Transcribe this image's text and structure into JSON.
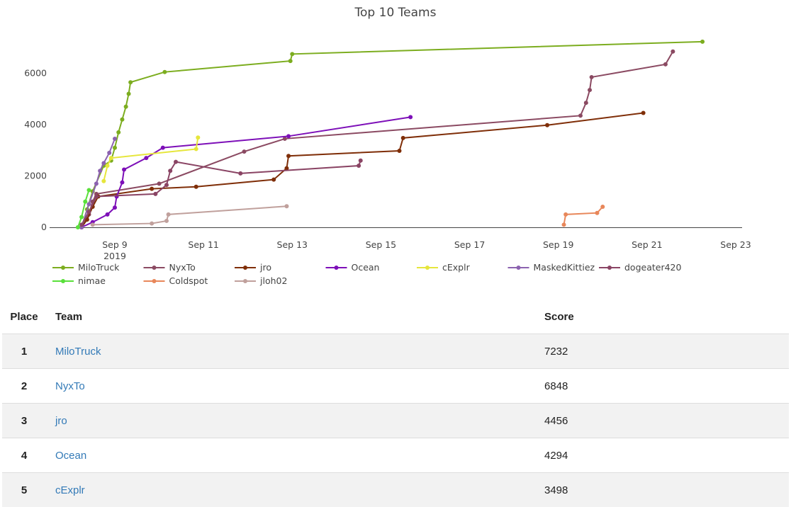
{
  "chart_data": {
    "type": "line",
    "title": "Top 10 Teams",
    "ylim": [
      0,
      7600
    ],
    "y_ticks": [
      0,
      2000,
      4000,
      6000
    ],
    "xlim": [
      "2019-09-07",
      "2019-09-24"
    ],
    "x_ticks": [
      {
        "date": "2019-09-09",
        "label": "Sep 9",
        "sub": "2019"
      },
      {
        "date": "2019-09-11",
        "label": "Sep 11"
      },
      {
        "date": "2019-09-13",
        "label": "Sep 13"
      },
      {
        "date": "2019-09-15",
        "label": "Sep 15"
      },
      {
        "date": "2019-09-17",
        "label": "Sep 17"
      },
      {
        "date": "2019-09-19",
        "label": "Sep 19"
      },
      {
        "date": "2019-09-21",
        "label": "Sep 21"
      },
      {
        "date": "2019-09-23",
        "label": "Sep 23"
      }
    ],
    "legend_position": "bottom",
    "grid": false,
    "series": [
      {
        "name": "MiloTruck",
        "color": "#7cad1f",
        "points": [
          [
            "2019-09-08 06:00",
            0
          ],
          [
            "2019-09-08 09:00",
            700
          ],
          [
            "2019-09-08 12:00",
            1400
          ],
          [
            "2019-09-08 18:00",
            2400
          ],
          [
            "2019-09-08 22:00",
            2600
          ],
          [
            "2019-09-09 00:00",
            3100
          ],
          [
            "2019-09-09 02:00",
            3700
          ],
          [
            "2019-09-09 04:00",
            4200
          ],
          [
            "2019-09-09 06:00",
            4700
          ],
          [
            "2019-09-09 07:30",
            5200
          ],
          [
            "2019-09-09 08:30",
            5650
          ],
          [
            "2019-09-10 03:00",
            6050
          ],
          [
            "2019-09-12 23:00",
            6480
          ],
          [
            "2019-09-13 00:00",
            6750
          ],
          [
            "2019-09-22 06:00",
            7232
          ]
        ]
      },
      {
        "name": "NyxTo",
        "color": "#8b4a62",
        "points": [
          [
            "2019-09-08 06:00",
            0
          ],
          [
            "2019-09-08 10:00",
            500
          ],
          [
            "2019-09-08 12:00",
            1000
          ],
          [
            "2019-09-08 14:00",
            1300
          ],
          [
            "2019-09-10 00:00",
            1700
          ],
          [
            "2019-09-11 22:00",
            2950
          ],
          [
            "2019-09-12 20:00",
            3450
          ],
          [
            "2019-09-19 12:00",
            4350
          ],
          [
            "2019-09-19 15:00",
            4850
          ],
          [
            "2019-09-19 17:00",
            5350
          ],
          [
            "2019-09-19 18:00",
            5850
          ],
          [
            "2019-09-21 10:00",
            6350
          ],
          [
            "2019-09-21 14:00",
            6848
          ]
        ]
      },
      {
        "name": "jro",
        "color": "#7f2e08",
        "points": [
          [
            "2019-09-08 06:00",
            0
          ],
          [
            "2019-09-08 09:00",
            300
          ],
          [
            "2019-09-08 12:00",
            800
          ],
          [
            "2019-09-08 15:00",
            1200
          ],
          [
            "2019-09-09 20:00",
            1500
          ],
          [
            "2019-09-10 20:00",
            1580
          ],
          [
            "2019-09-12 14:00",
            1860
          ],
          [
            "2019-09-12 21:00",
            2300
          ],
          [
            "2019-09-12 22:00",
            2780
          ],
          [
            "2019-09-15 10:00",
            2980
          ],
          [
            "2019-09-15 12:00",
            3480
          ],
          [
            "2019-09-18 18:00",
            3980
          ],
          [
            "2019-09-20 22:00",
            4456
          ]
        ]
      },
      {
        "name": "Ocean",
        "color": "#7d0fb8",
        "points": [
          [
            "2019-09-08 06:00",
            0
          ],
          [
            "2019-09-08 12:00",
            200
          ],
          [
            "2019-09-08 20:00",
            500
          ],
          [
            "2019-09-09 00:00",
            770
          ],
          [
            "2019-09-09 01:00",
            1200
          ],
          [
            "2019-09-09 04:00",
            1750
          ],
          [
            "2019-09-09 05:00",
            2250
          ],
          [
            "2019-09-09 17:00",
            2700
          ],
          [
            "2019-09-10 02:00",
            3100
          ],
          [
            "2019-09-12 22:00",
            3550
          ],
          [
            "2019-09-15 16:00",
            4294
          ]
        ]
      },
      {
        "name": "cExplr",
        "color": "#e6e63c",
        "points": [
          [
            "2019-09-08 18:00",
            1800
          ],
          [
            "2019-09-08 20:00",
            2400
          ],
          [
            "2019-09-08 22:00",
            2700
          ],
          [
            "2019-09-10 20:00",
            3050
          ],
          [
            "2019-09-10 21:00",
            3498
          ]
        ]
      },
      {
        "name": "MaskedKittiez",
        "color": "#8c62b0",
        "points": [
          [
            "2019-09-08 06:00",
            0
          ],
          [
            "2019-09-08 10:00",
            900
          ],
          [
            "2019-09-08 14:00",
            1700
          ],
          [
            "2019-09-08 16:00",
            2200
          ],
          [
            "2019-09-08 18:00",
            2500
          ],
          [
            "2019-09-08 21:00",
            2900
          ],
          [
            "2019-09-09 00:00",
            3450
          ]
        ]
      },
      {
        "name": "dogeater420",
        "color": "#8a4464",
        "points": [
          [
            "2019-09-08 06:00",
            100
          ],
          [
            "2019-09-08 10:00",
            600
          ],
          [
            "2019-09-08 14:00",
            1200
          ],
          [
            "2019-09-09 22:00",
            1300
          ],
          [
            "2019-09-10 04:00",
            1650
          ],
          [
            "2019-09-10 06:00",
            2200
          ],
          [
            "2019-09-10 09:00",
            2550
          ],
          [
            "2019-09-11 20:00",
            2100
          ],
          [
            "2019-09-14 12:00",
            2400
          ],
          [
            "2019-09-14 13:00",
            2600
          ]
        ]
      },
      {
        "name": "nimae",
        "color": "#59e03a",
        "points": [
          [
            "2019-09-08 04:00",
            0
          ],
          [
            "2019-09-08 06:00",
            400
          ],
          [
            "2019-09-08 08:00",
            1000
          ],
          [
            "2019-09-08 10:00",
            1450
          ]
        ]
      },
      {
        "name": "Coldspot",
        "color": "#e8875a",
        "points": [
          [
            "2019-09-19 03:00",
            100
          ],
          [
            "2019-09-19 04:00",
            500
          ],
          [
            "2019-09-19 21:00",
            560
          ],
          [
            "2019-09-20 00:00",
            800
          ]
        ]
      },
      {
        "name": "jloh02",
        "color": "#c0a09c",
        "points": [
          [
            "2019-09-08 12:00",
            100
          ],
          [
            "2019-09-09 20:00",
            150
          ],
          [
            "2019-09-10 04:00",
            250
          ],
          [
            "2019-09-10 05:00",
            500
          ],
          [
            "2019-09-12 21:00",
            820
          ]
        ]
      }
    ]
  },
  "scoreboard": {
    "headers": {
      "place": "Place",
      "team": "Team",
      "score": "Score"
    },
    "rows": [
      {
        "place": "1",
        "team": "MiloTruck",
        "score": "7232"
      },
      {
        "place": "2",
        "team": "NyxTo",
        "score": "6848"
      },
      {
        "place": "3",
        "team": "jro",
        "score": "4456"
      },
      {
        "place": "4",
        "team": "Ocean",
        "score": "4294"
      },
      {
        "place": "5",
        "team": "cExplr",
        "score": "3498"
      }
    ]
  }
}
